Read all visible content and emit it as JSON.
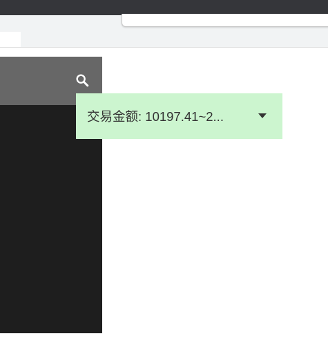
{
  "filter": {
    "label": "交易金额: 10197.41~2..."
  },
  "icons": {
    "search": "search-icon",
    "caret": "caret-down-icon"
  },
  "colors": {
    "sidebar_bg": "#1e1e1e",
    "sidebar_header_bg": "#676767",
    "filter_bg": "#ccf5cf",
    "titlebar_bg": "#35363a"
  }
}
